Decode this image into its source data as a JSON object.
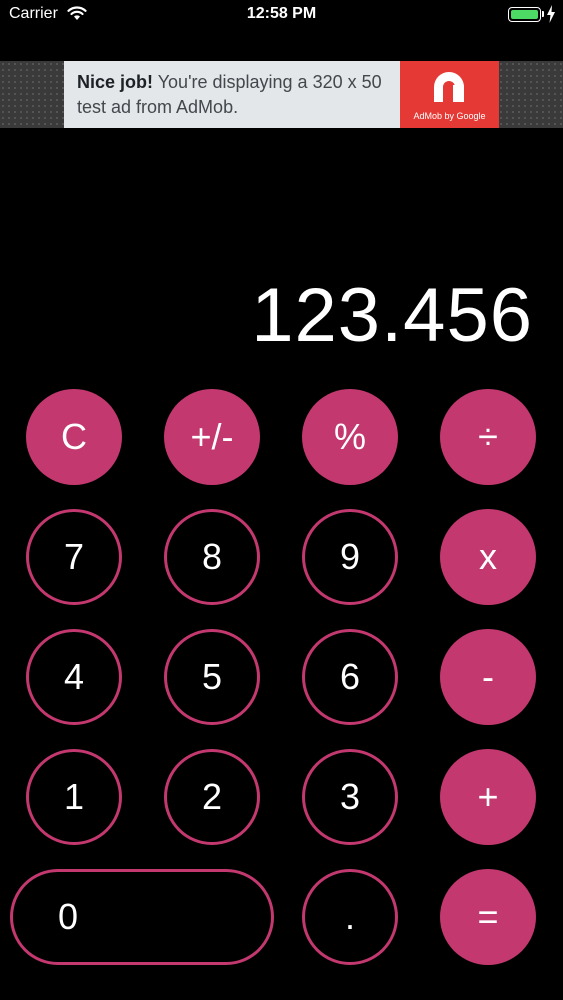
{
  "status_bar": {
    "carrier": "Carrier",
    "time": "12:58 PM",
    "battery_color": "#4cd964"
  },
  "ad": {
    "headline": "Nice job!",
    "body": " You're displaying a 320 x 50 test ad from AdMob.",
    "brand_caption": "AdMob by Google",
    "brand_color": "#e53935"
  },
  "display": {
    "value": "123.456"
  },
  "theme": {
    "accent": "#c2386f",
    "background": "#000000"
  },
  "keys": {
    "clear": "C",
    "negate": "+/-",
    "percent": "%",
    "divide": "÷",
    "seven": "7",
    "eight": "8",
    "nine": "9",
    "multiply": "x",
    "four": "4",
    "five": "5",
    "six": "6",
    "subtract": "-",
    "one": "1",
    "two": "2",
    "three": "3",
    "add": "+",
    "zero": "0",
    "decimal": ".",
    "equals": "="
  }
}
